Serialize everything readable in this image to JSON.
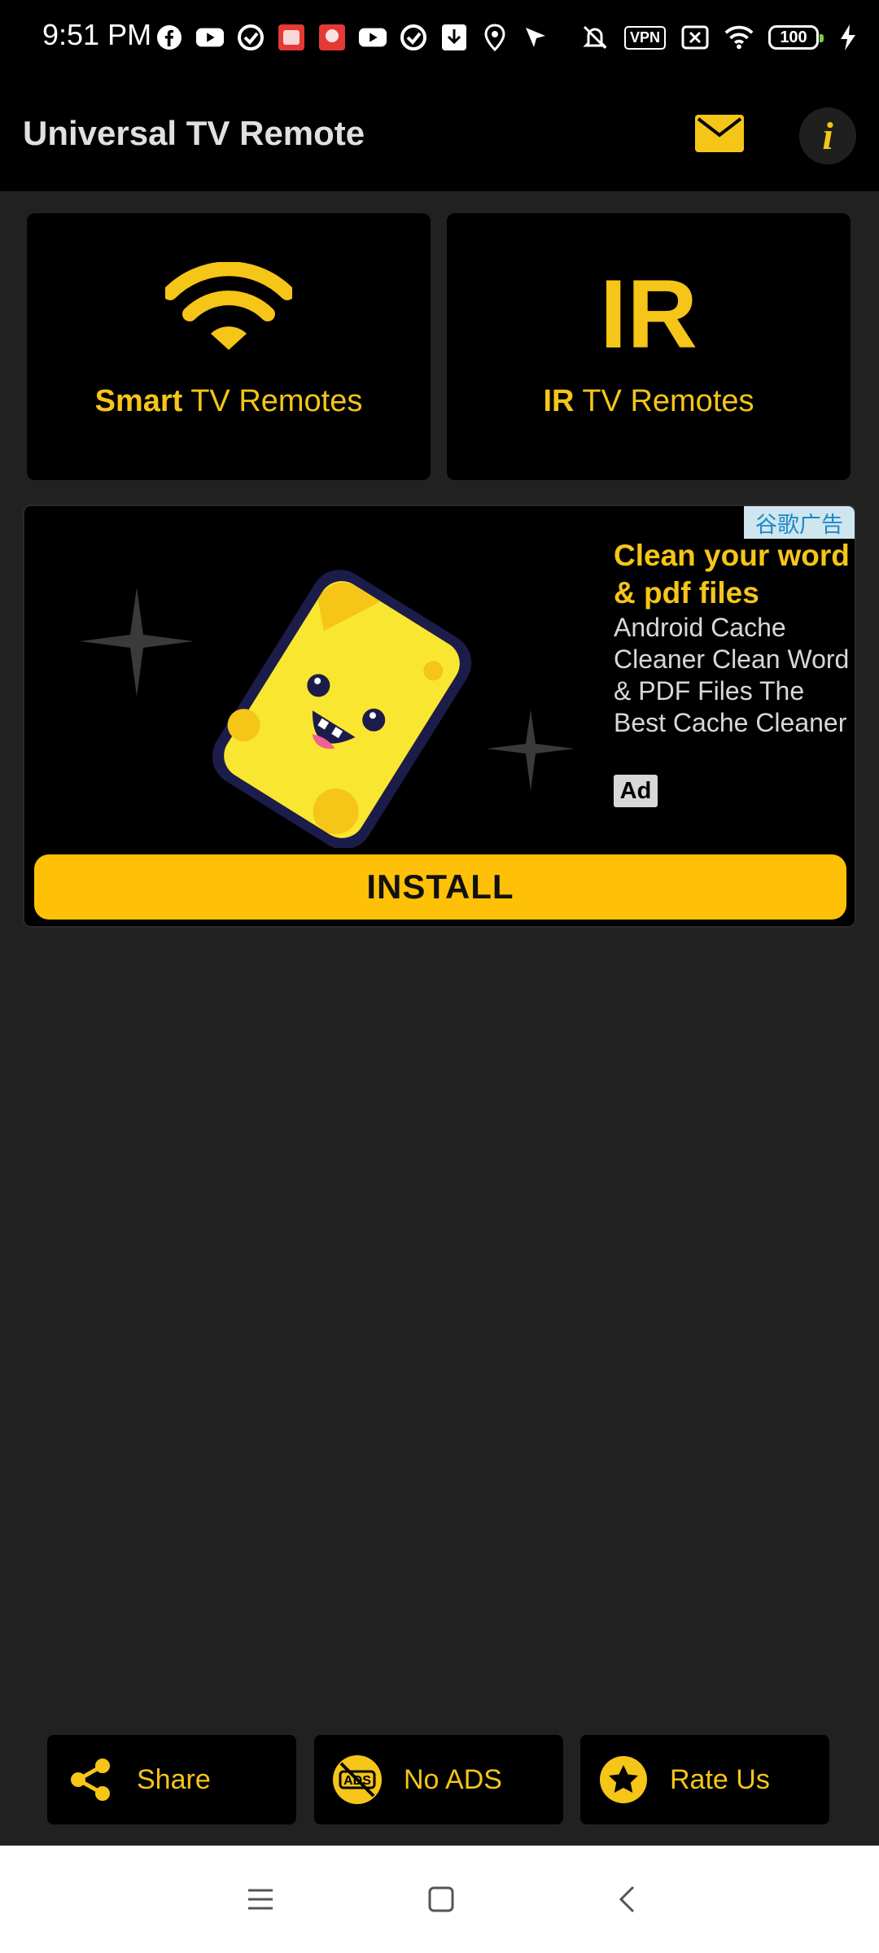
{
  "status_bar": {
    "time": "9:51 PM",
    "vpn_label": "VPN",
    "battery": "100"
  },
  "app_bar": {
    "title": "Universal TV Remote",
    "icons": {
      "mail": "mail-icon",
      "info": "info-icon",
      "info_glyph": "i"
    }
  },
  "remotes": {
    "smart": {
      "bold": "Smart",
      "rest": " TV Remotes",
      "icon": "wifi-icon"
    },
    "ir": {
      "glyph": "IR",
      "bold": "IR",
      "rest": " TV Remotes"
    }
  },
  "ad": {
    "choice_label": "谷歌广告",
    "headline": "Clean your word & pdf files",
    "body": "Android Cache Cleaner Clean Word & PDF Files The Best Cache Cleaner",
    "badge": "Ad",
    "cta": "INSTALL"
  },
  "actions": [
    {
      "label": "Share",
      "icon": "share-icon"
    },
    {
      "label": "No ADS",
      "icon": "no-ads-icon",
      "icon_text": "ADS"
    },
    {
      "label": "Rate Us",
      "icon": "star-icon"
    }
  ],
  "colors": {
    "accent": "#f5c518",
    "background": "#212121",
    "card": "#000000",
    "install": "#ffc107"
  }
}
